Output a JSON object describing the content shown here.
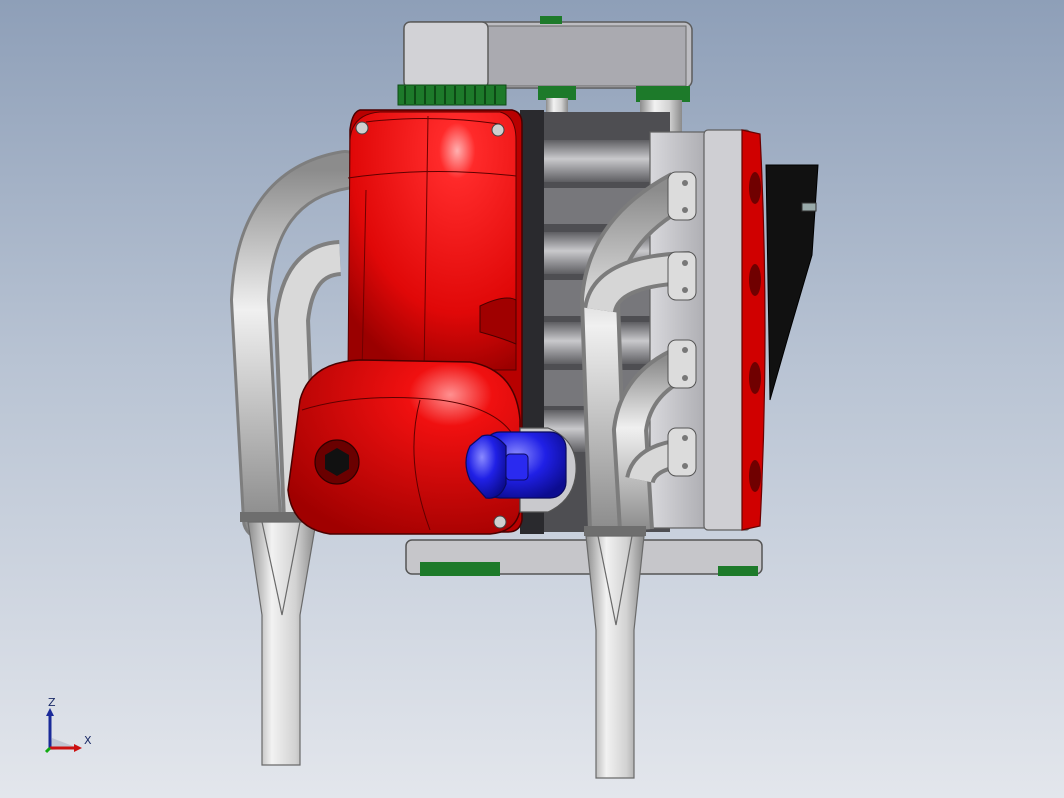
{
  "viewport": {
    "background_top": "#8e9fb8",
    "background_bottom": "#e3e6ec"
  },
  "model": {
    "colors": {
      "cover_red": "#e00808",
      "cover_dark": "#9a0000",
      "pipe_light": "#dcdcdc",
      "pipe_shade": "#8c8c8c",
      "block_gray": "#b9b9bd",
      "cap_blue": "#1a1ae0",
      "gear_green": "#1d7a2a",
      "duct_black": "#111111"
    }
  },
  "triad": {
    "z_label": "Z",
    "x_label": "X",
    "z_color": "#1a2a99",
    "x_color": "#cc1111",
    "y_color": "#11aa11"
  }
}
